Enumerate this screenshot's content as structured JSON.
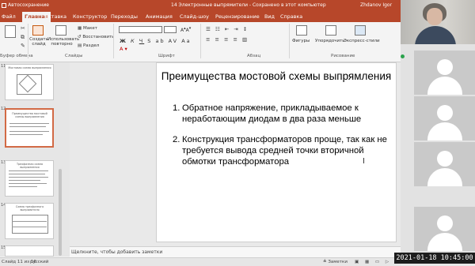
{
  "app": {
    "titlebar_left": "Автосохранение",
    "titlebar_center": "14 Электронные выпрямители - Сохранено в этот компьютер",
    "titlebar_user": "Zhdanov Igor"
  },
  "tabs": [
    "Файл",
    "Главная",
    "Вставка",
    "Конструктор",
    "Переходы",
    "Анимация",
    "Слайд-шоу",
    "Рецензирование",
    "Вид",
    "Справка"
  ],
  "ribbon": {
    "create_slide": "Создать слайд",
    "reuse_slides": "Использовать повторно",
    "layout": "Макет",
    "reset": "Восстановить",
    "section": "Раздел",
    "shapes": "Фигуры",
    "arrange": "Упорядочить",
    "quick_styles": "Экспресс-стили",
    "groups": {
      "clipboard": "Буфер обмена",
      "slides": "Слайды",
      "font": "Шрифт",
      "paragraph": "Абзац",
      "drawing": "Рисование"
    }
  },
  "thumbnails": [
    {
      "num": "11",
      "text": "Мостовая схема выпрямления"
    },
    {
      "num": "12",
      "text": "Преимущества мостовой схемы выпрямления",
      "selected": true
    },
    {
      "num": "13",
      "text": "Трехфазная схема выпрямления"
    },
    {
      "num": "14",
      "text": "Схема трехфазного выпрямителя"
    },
    {
      "num": "15",
      "text": ""
    }
  ],
  "slide": {
    "title": "Преимущества мостовой схемы выпрямления",
    "bullets": [
      {
        "num": "1.",
        "text": "Обратное напряжение, прикладываемое к неработающим диодам в два раза меньше"
      },
      {
        "num": "2.",
        "text": "Конструкция трансформаторов проще, так как не требуется вывода средней точки вторичной обмотки трансформатора"
      }
    ]
  },
  "notes_placeholder": "Щелкните, чтобы добавить заметки",
  "status": {
    "slide_counter": "Слайд 11 из 16",
    "language": "русский",
    "notes_button": "Заметки"
  },
  "datetime": "2021-01-18  10:45:00"
}
